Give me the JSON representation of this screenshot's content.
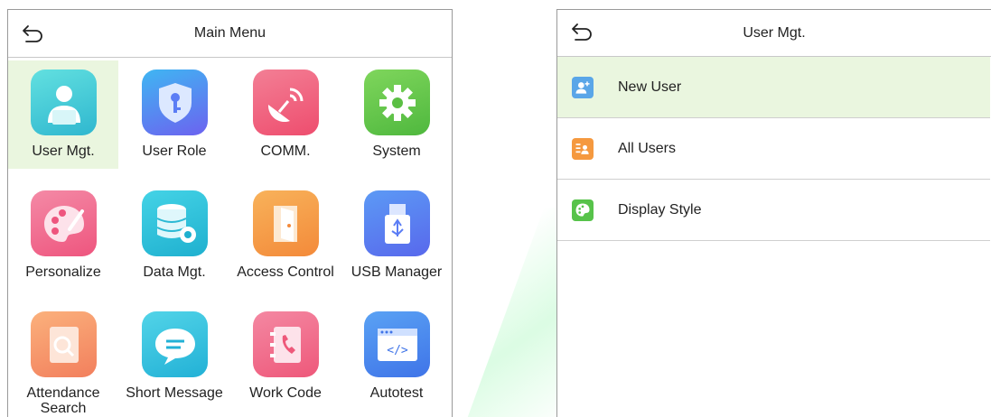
{
  "main_menu": {
    "title": "Main Menu",
    "items": [
      {
        "label": "User Mgt.",
        "icon": "user-icon",
        "color": "#4fd1d9",
        "selected": true
      },
      {
        "label": "User Role",
        "icon": "shield-key-icon",
        "color": "#5b7df5"
      },
      {
        "label": "COMM.",
        "icon": "satellite-dish-icon",
        "color": "#f2607a"
      },
      {
        "label": "System",
        "icon": "gear-icon",
        "color": "#6ccf55"
      },
      {
        "label": "Personalize",
        "icon": "palette-icon",
        "color": "#f0608a"
      },
      {
        "label": "Data Mgt.",
        "icon": "database-gear-icon",
        "color": "#30c6dc"
      },
      {
        "label": "Access Control",
        "icon": "door-icon",
        "color": "#f6a04a"
      },
      {
        "label": "USB Manager",
        "icon": "usb-drive-icon",
        "color": "#5b7df5"
      },
      {
        "label": "Attendance Search",
        "icon": "document-search-icon",
        "color": "#f79a6a"
      },
      {
        "label": "Short Message",
        "icon": "chat-bubble-icon",
        "color": "#3cc7e0"
      },
      {
        "label": "Work Code",
        "icon": "phone-book-icon",
        "color": "#f2607a"
      },
      {
        "label": "Autotest",
        "icon": "code-window-icon",
        "color": "#4d8af0"
      }
    ]
  },
  "user_mgt": {
    "title": "User Mgt.",
    "items": [
      {
        "label": "New User",
        "icon": "add-user-icon",
        "color": "#5aa6e8",
        "selected": true
      },
      {
        "label": "All Users",
        "icon": "user-list-icon",
        "color": "#f5993f"
      },
      {
        "label": "Display Style",
        "icon": "palette-icon",
        "color": "#57c34a"
      }
    ]
  }
}
